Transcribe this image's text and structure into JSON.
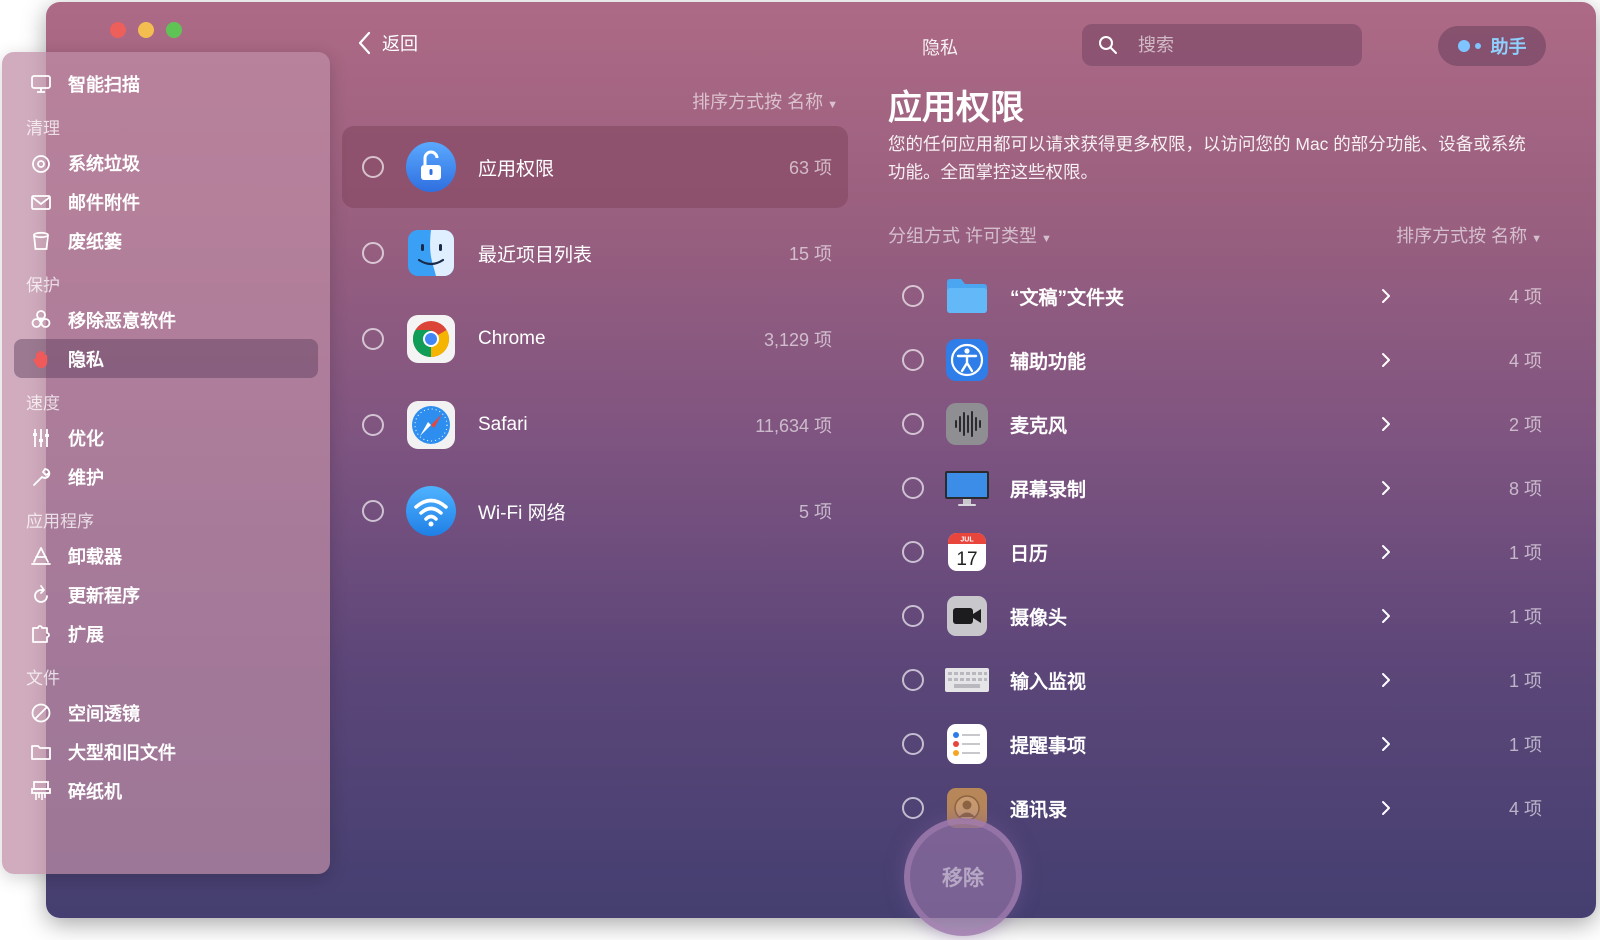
{
  "window": {
    "title": "隐私"
  },
  "sidebar": {
    "items": [
      {
        "label": "智能扫描",
        "icon": "monitor-scan-icon"
      },
      {
        "section": "清理"
      },
      {
        "label": "系统垃圾",
        "icon": "system-junk-icon"
      },
      {
        "label": "邮件附件",
        "icon": "mail-icon"
      },
      {
        "label": "废纸篓",
        "icon": "trash-icon"
      },
      {
        "section": "保护"
      },
      {
        "label": "移除恶意软件",
        "icon": "biohazard-icon"
      },
      {
        "label": "隐私",
        "icon": "hand-icon",
        "active": true
      },
      {
        "section": "速度"
      },
      {
        "label": "优化",
        "icon": "sliders-icon"
      },
      {
        "label": "维护",
        "icon": "wrench-icon"
      },
      {
        "section": "应用程序"
      },
      {
        "label": "卸载器",
        "icon": "uninstaller-icon"
      },
      {
        "label": "更新程序",
        "icon": "updater-icon"
      },
      {
        "label": "扩展",
        "icon": "extensions-icon"
      },
      {
        "section": "文件"
      },
      {
        "label": "空间透镜",
        "icon": "space-lens-icon"
      },
      {
        "label": "大型和旧文件",
        "icon": "folder-icon"
      },
      {
        "label": "碎纸机",
        "icon": "shredder-icon"
      }
    ]
  },
  "topbar": {
    "back_label": "返回",
    "title": "隐私",
    "search_placeholder": "搜索",
    "assistant_label": "助手"
  },
  "middle": {
    "sort_label": "排序方式按 名称",
    "apps": [
      {
        "name": "应用权限",
        "count": "63 项",
        "icon": "lock-open-icon",
        "selected": true
      },
      {
        "name": "最近项目列表",
        "count": "15 项",
        "icon": "finder-icon"
      },
      {
        "name": "Chrome",
        "count": "3,129 项",
        "icon": "chrome-icon"
      },
      {
        "name": "Safari",
        "count": "11,634 项",
        "icon": "safari-icon"
      },
      {
        "name": "Wi-Fi 网络",
        "count": "5 项",
        "icon": "wifi-icon"
      }
    ]
  },
  "detail": {
    "title": "应用权限",
    "description": "您的任何应用都可以请求获得更多权限，以访问您的 Mac 的部分功能、设备或系统功能。全面掌控这些权限。",
    "group_label": "分组方式 许可类型",
    "sort_label": "排序方式按 名称",
    "permissions": [
      {
        "name": "“文稿”文件夹",
        "count": "4 项",
        "icon": "documents-folder-icon"
      },
      {
        "name": "辅助功能",
        "count": "4 项",
        "icon": "accessibility-icon"
      },
      {
        "name": "麦克风",
        "count": "2 项",
        "icon": "microphone-icon"
      },
      {
        "name": "屏幕录制",
        "count": "8 项",
        "icon": "display-icon"
      },
      {
        "name": "日历",
        "count": "1 项",
        "icon": "calendar-icon",
        "calendar_month": "JUL",
        "calendar_day": "17"
      },
      {
        "name": "摄像头",
        "count": "1 项",
        "icon": "camera-icon"
      },
      {
        "name": "输入监视",
        "count": "1 项",
        "icon": "keyboard-icon"
      },
      {
        "name": "提醒事项",
        "count": "1 项",
        "icon": "reminders-icon"
      },
      {
        "name": "通讯录",
        "count": "4 项",
        "icon": "contacts-icon"
      }
    ]
  },
  "remove_button": {
    "label": "移除"
  },
  "colors": {
    "accent": "#8fd0ff",
    "bg_top": "#ad6a86",
    "bg_bottom": "#443f70"
  }
}
